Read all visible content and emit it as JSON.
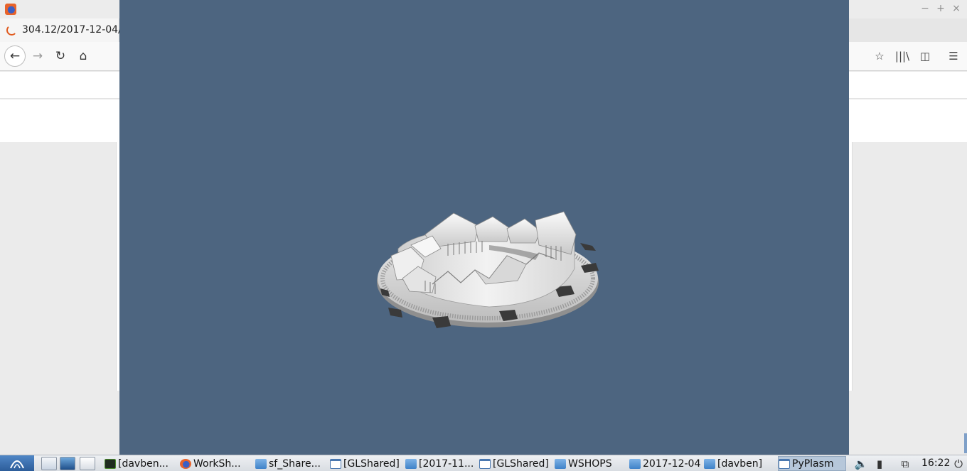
{
  "browser": {
    "tab_title": "304.12/2017-12-04/",
    "window_controls": {
      "minimize": "−",
      "maximize": "+",
      "close": "×"
    },
    "nav": {
      "back": "←",
      "forward": "→",
      "reload": "↻",
      "home": "⌂"
    },
    "toolbar_right": {
      "library": "|||\\",
      "sidebar": "◫",
      "menu": "☰",
      "bookmark": "☆"
    }
  },
  "taskbar": {
    "tasks": [
      {
        "label": "[davben...",
        "icon": "terminal-icon"
      },
      {
        "label": "WorkSh...",
        "icon": "firefox-icon"
      },
      {
        "label": "sf_Share...",
        "icon": "folder-icon"
      },
      {
        "label": "[GLShared]",
        "icon": "window-icon"
      },
      {
        "label": "[2017-11...",
        "icon": "folder-icon"
      },
      {
        "label": "[GLShared]",
        "icon": "window-icon"
      },
      {
        "label": "WSHOPS",
        "icon": "folder-icon"
      },
      {
        "label": "2017-12-04",
        "icon": "folder-icon"
      },
      {
        "label": "[davben]",
        "icon": "folder-icon"
      },
      {
        "label": "PyPlasm",
        "icon": "window-icon",
        "active": true
      }
    ],
    "tray": {
      "volume": "🔈",
      "battery": "▮",
      "network": "⧉",
      "power": "⏻"
    },
    "clock": "16:22"
  },
  "colors": {
    "gl_background": "#4d6580",
    "taskbar_active": "#b6c7da"
  }
}
